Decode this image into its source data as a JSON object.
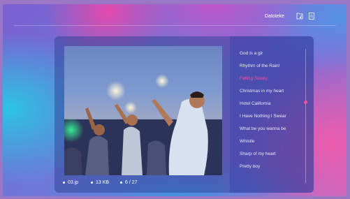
{
  "header": {
    "title": "Datoteke",
    "icons": [
      "folder-music-icon",
      "file-icon"
    ]
  },
  "photo_info": {
    "filename": "03.jp",
    "size": "13 KB",
    "position": "6 / 27"
  },
  "playlist": {
    "active_index": 2,
    "items": [
      {
        "label": "God is a gir"
      },
      {
        "label": "Rhythm of the Rain!"
      },
      {
        "label": "Falling Slowly"
      },
      {
        "label": "Christmas in my heart"
      },
      {
        "label": "Hotel California"
      },
      {
        "label": "I Have Nothing I Swear"
      },
      {
        "label": "What be you wanna be"
      },
      {
        "label": "Whistle"
      },
      {
        "label": "Sharp of my heart"
      },
      {
        "label": "Pretty boy"
      }
    ],
    "scroll_fraction": 0.4
  },
  "colors": {
    "accent": "#ff4f9a",
    "text": "#ffffff"
  }
}
